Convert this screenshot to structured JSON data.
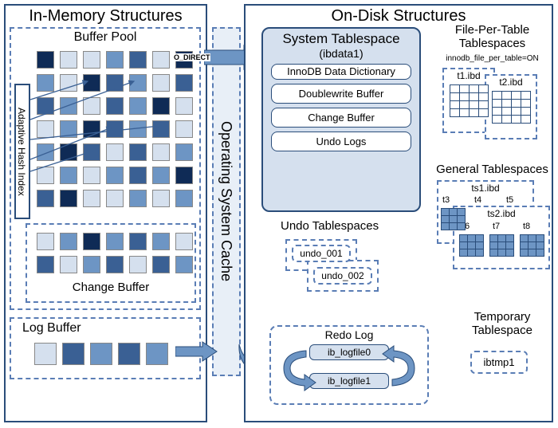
{
  "inMemory": {
    "title": "In-Memory Structures",
    "bufferPool": "Buffer Pool",
    "adaptiveHash": "Adaptive Hash Index",
    "changeBuffer": "Change Buffer",
    "logBuffer": "Log Buffer"
  },
  "middle": {
    "osCache": "Operating System Cache",
    "oDirect": "O_DIRECT"
  },
  "onDisk": {
    "title": "On-Disk Structures",
    "systemTablespace": {
      "title": "System Tablespace",
      "subtitle": "(ibdata1)",
      "items": [
        "InnoDB Data Dictionary",
        "Doublewrite Buffer",
        "Change Buffer",
        "Undo Logs"
      ]
    },
    "undoTablespaces": {
      "title": "Undo Tablespaces",
      "items": [
        "undo_001",
        "undo_002"
      ]
    },
    "redoLog": {
      "title": "Redo Log",
      "items": [
        "ib_logfile0",
        "ib_logfile1"
      ]
    },
    "filePerTable": {
      "title": "File-Per-Table Tablespaces",
      "option": "innodb_file_per_table=ON",
      "files": [
        "t1.ibd",
        "t2.ibd"
      ]
    },
    "generalTablespaces": {
      "title": "General Tablespaces",
      "ts1": {
        "file": "ts1.ibd",
        "tables": [
          "t3",
          "t4",
          "t5"
        ]
      },
      "ts2": {
        "file": "ts2.ibd",
        "tables": [
          "t6",
          "t7",
          "t8"
        ]
      }
    },
    "temporary": {
      "title": "Temporary Tablespace",
      "file": "ibtmp1"
    }
  }
}
